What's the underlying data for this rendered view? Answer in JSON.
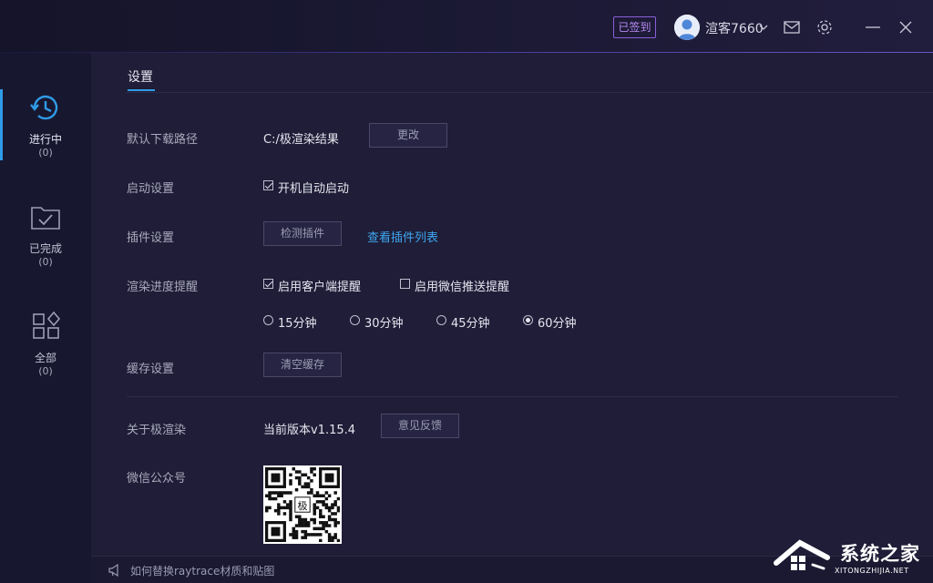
{
  "titlebar": {
    "signed_badge": "已签到",
    "username": "渲客7660"
  },
  "sidebar": {
    "items": [
      {
        "label": "进行中",
        "count": "(0)",
        "icon": "history-clock-icon"
      },
      {
        "label": "已完成",
        "count": "(0)",
        "icon": "folder-check-icon"
      },
      {
        "label": "全部",
        "count": "(0)",
        "icon": "grid-icon"
      }
    ]
  },
  "tab": {
    "label": "设置"
  },
  "settings": {
    "download_path": {
      "label": "默认下载路径",
      "value": "C:/极渲染结果",
      "button": "更改"
    },
    "startup": {
      "label": "启动设置",
      "option": "开机自动启动",
      "checked": true
    },
    "plugins": {
      "label": "插件设置",
      "button": "检测插件",
      "link": "查看插件列表"
    },
    "progress_reminder": {
      "label": "渲染进度提醒",
      "client": {
        "text": "启用客户端提醒",
        "checked": true
      },
      "wechat": {
        "text": "启用微信推送提醒",
        "checked": false
      },
      "intervals": [
        "15分钟",
        "30分钟",
        "45分钟",
        "60分钟"
      ],
      "selected_interval": "60分钟"
    },
    "cache": {
      "label": "缓存设置",
      "button": "清空缓存"
    },
    "about": {
      "label": "关于极渲染",
      "version": "当前版本v1.15.4",
      "button": "意见反馈"
    },
    "wechat_account": {
      "label": "微信公众号",
      "qr_center_char": "极"
    }
  },
  "bottombar": {
    "tip": "如何替换raytrace材质和贴图"
  },
  "watermark": {
    "title": "系统之家",
    "subtitle": "XITONGZHIJIA.NET"
  },
  "colors": {
    "accent": "#2f9ce8",
    "link": "#3ea6f0",
    "badge": "#8a5fd8",
    "background": "#1f1d37"
  }
}
